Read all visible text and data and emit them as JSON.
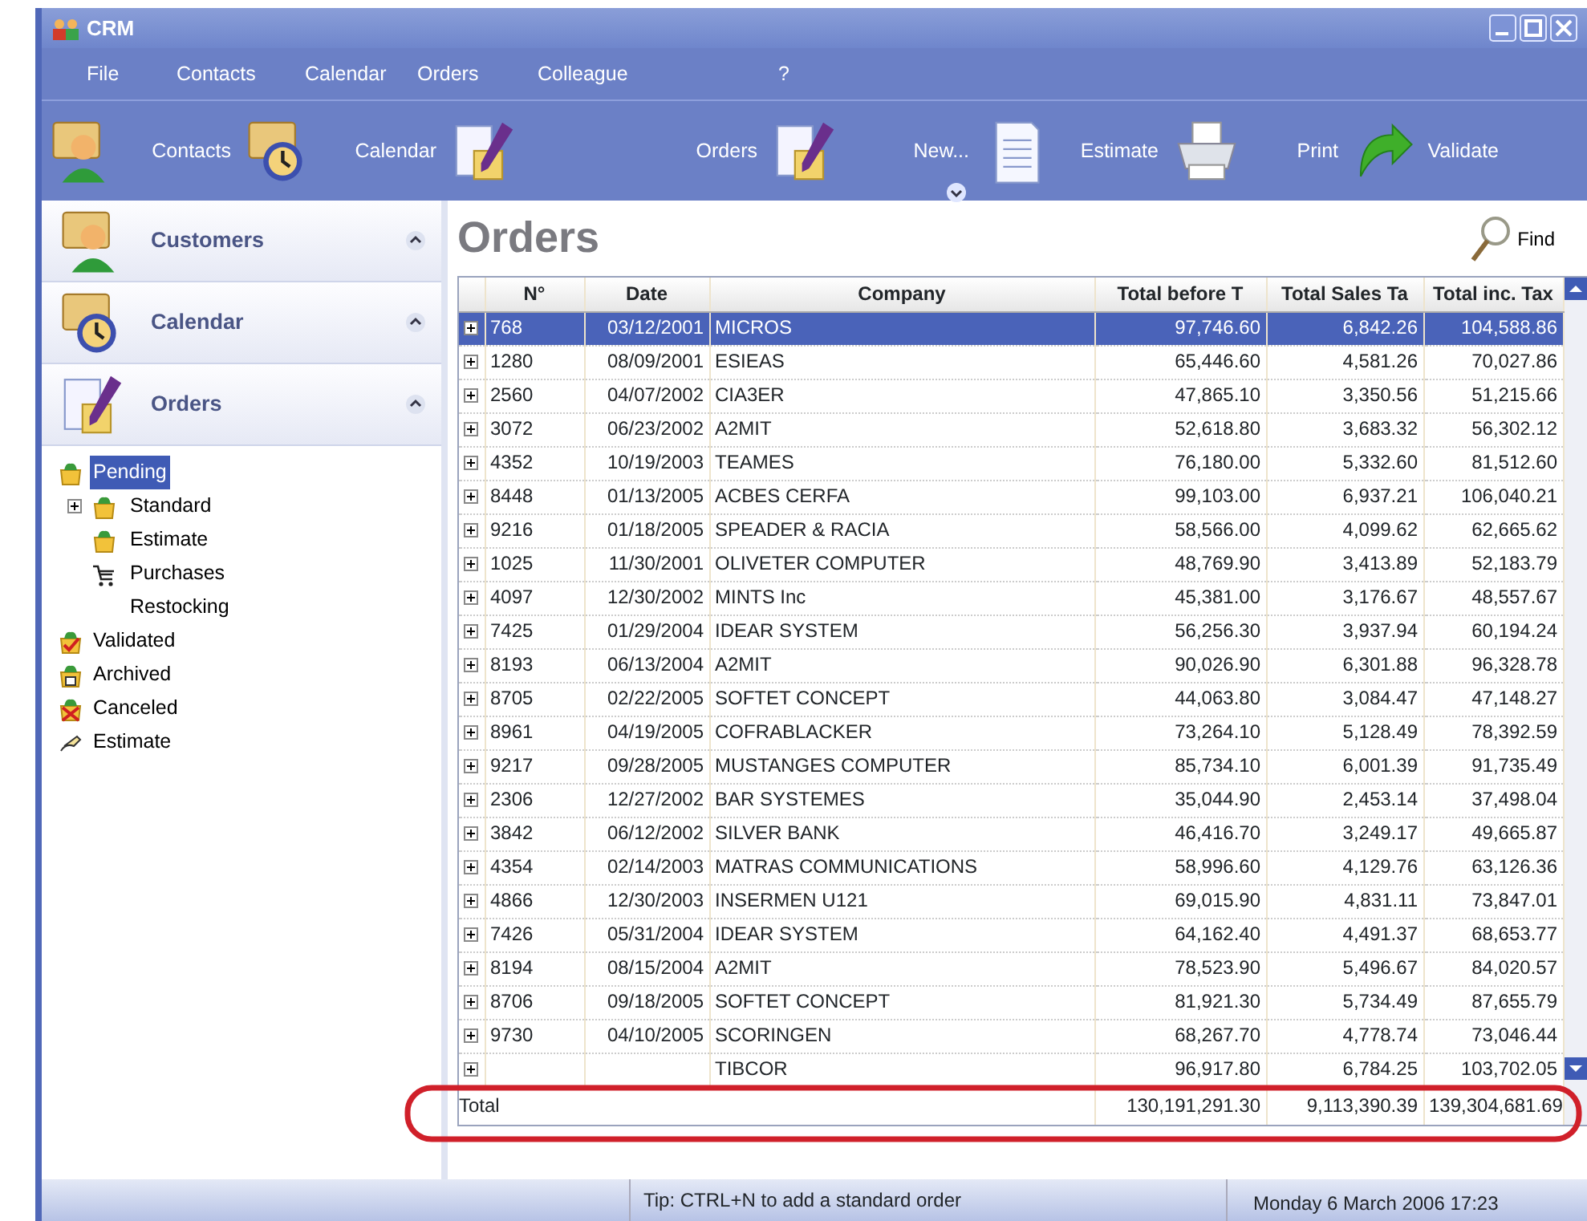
{
  "window": {
    "title": "CRM"
  },
  "menu": [
    "File",
    "Contacts",
    "Calendar",
    "Orders",
    "Colleague",
    "?"
  ],
  "toolbar": [
    {
      "label": "Contacts",
      "kind": "contacts"
    },
    {
      "label": "Calendar",
      "kind": "calendar"
    },
    {
      "label": "Orders",
      "kind": "orders"
    },
    {
      "label": "New...",
      "kind": "new"
    },
    {
      "label": "Estimate",
      "kind": "estimate"
    },
    {
      "label": "Print",
      "kind": "print"
    },
    {
      "label": "Validate",
      "kind": "validate"
    }
  ],
  "sidebar": {
    "panels": [
      {
        "title": "Customers",
        "kind": "contacts"
      },
      {
        "title": "Calendar",
        "kind": "calendar"
      },
      {
        "title": "Orders",
        "kind": "orders"
      }
    ],
    "tree": [
      {
        "label": "Pending",
        "kind": "bag",
        "selected": true,
        "children": [
          {
            "label": "Standard",
            "kind": "bag",
            "selected": false,
            "expandable": true
          },
          {
            "label": "Estimate",
            "kind": "bag",
            "selected": false
          },
          {
            "label": "Purchases",
            "kind": "cart",
            "selected": false
          },
          {
            "label": "Restocking",
            "kind": "none",
            "selected": false
          }
        ]
      },
      {
        "label": "Validated",
        "kind": "check",
        "selected": false
      },
      {
        "label": "Archived",
        "kind": "archive",
        "selected": false
      },
      {
        "label": "Canceled",
        "kind": "cancel",
        "selected": false
      },
      {
        "label": "Estimate",
        "kind": "pen",
        "selected": false
      }
    ]
  },
  "main": {
    "title": "Orders",
    "find_label": "Find",
    "table": {
      "columns": [
        "N°",
        "Date",
        "Company",
        "Total before T",
        "Total Sales Ta",
        "Total inc. Tax"
      ],
      "rows": [
        {
          "no": "768",
          "date": "03/12/2001",
          "company": "MICROS",
          "before": "97,746.60",
          "tax": "6,842.26",
          "total": "104,588.86",
          "selected": true
        },
        {
          "no": "1280",
          "date": "08/09/2001",
          "company": "ESIEAS",
          "before": "65,446.60",
          "tax": "4,581.26",
          "total": "70,027.86",
          "selected": false
        },
        {
          "no": "2560",
          "date": "04/07/2002",
          "company": "CIA3ER",
          "before": "47,865.10",
          "tax": "3,350.56",
          "total": "51,215.66",
          "selected": false
        },
        {
          "no": "3072",
          "date": "06/23/2002",
          "company": "A2MIT",
          "before": "52,618.80",
          "tax": "3,683.32",
          "total": "56,302.12",
          "selected": false
        },
        {
          "no": "4352",
          "date": "10/19/2003",
          "company": "TEAMES",
          "before": "76,180.00",
          "tax": "5,332.60",
          "total": "81,512.60",
          "selected": false
        },
        {
          "no": "8448",
          "date": "01/13/2005",
          "company": "ACBES CERFA",
          "before": "99,103.00",
          "tax": "6,937.21",
          "total": "106,040.21",
          "selected": false
        },
        {
          "no": "9216",
          "date": "01/18/2005",
          "company": "SPEADER & RACIA",
          "before": "58,566.00",
          "tax": "4,099.62",
          "total": "62,665.62",
          "selected": false
        },
        {
          "no": "1025",
          "date": "11/30/2001",
          "company": "OLIVETER COMPUTER",
          "before": "48,769.90",
          "tax": "3,413.89",
          "total": "52,183.79",
          "selected": false
        },
        {
          "no": "4097",
          "date": "12/30/2002",
          "company": "MINTS Inc",
          "before": "45,381.00",
          "tax": "3,176.67",
          "total": "48,557.67",
          "selected": false
        },
        {
          "no": "7425",
          "date": "01/29/2004",
          "company": "IDEAR SYSTEM",
          "before": "56,256.30",
          "tax": "3,937.94",
          "total": "60,194.24",
          "selected": false
        },
        {
          "no": "8193",
          "date": "06/13/2004",
          "company": "A2MIT",
          "before": "90,026.90",
          "tax": "6,301.88",
          "total": "96,328.78",
          "selected": false
        },
        {
          "no": "8705",
          "date": "02/22/2005",
          "company": "SOFTET CONCEPT",
          "before": "44,063.80",
          "tax": "3,084.47",
          "total": "47,148.27",
          "selected": false
        },
        {
          "no": "8961",
          "date": "04/19/2005",
          "company": "COFRABLACKER",
          "before": "73,264.10",
          "tax": "5,128.49",
          "total": "78,392.59",
          "selected": false
        },
        {
          "no": "9217",
          "date": "09/28/2005",
          "company": "MUSTANGES COMPUTER",
          "before": "85,734.10",
          "tax": "6,001.39",
          "total": "91,735.49",
          "selected": false
        },
        {
          "no": "2306",
          "date": "12/27/2002",
          "company": "BAR SYSTEMES",
          "before": "35,044.90",
          "tax": "2,453.14",
          "total": "37,498.04",
          "selected": false
        },
        {
          "no": "3842",
          "date": "06/12/2002",
          "company": "SILVER BANK",
          "before": "46,416.70",
          "tax": "3,249.17",
          "total": "49,665.87",
          "selected": false
        },
        {
          "no": "4354",
          "date": "02/14/2003",
          "company": "MATRAS COMMUNICATIONS",
          "before": "58,996.60",
          "tax": "4,129.76",
          "total": "63,126.36",
          "selected": false
        },
        {
          "no": "4866",
          "date": "12/30/2003",
          "company": "INSERMEN U121",
          "before": "69,015.90",
          "tax": "4,831.11",
          "total": "73,847.01",
          "selected": false
        },
        {
          "no": "7426",
          "date": "05/31/2004",
          "company": "IDEAR SYSTEM",
          "before": "64,162.40",
          "tax": "4,491.37",
          "total": "68,653.77",
          "selected": false
        },
        {
          "no": "8194",
          "date": "08/15/2004",
          "company": "A2MIT",
          "before": "78,523.90",
          "tax": "5,496.67",
          "total": "84,020.57",
          "selected": false
        },
        {
          "no": "8706",
          "date": "09/18/2005",
          "company": "SOFTET CONCEPT",
          "before": "81,921.30",
          "tax": "5,734.49",
          "total": "87,655.79",
          "selected": false
        },
        {
          "no": "9730",
          "date": "04/10/2005",
          "company": "SCORINGEN",
          "before": "68,267.70",
          "tax": "4,778.74",
          "total": "73,046.44",
          "selected": false
        },
        {
          "company": "TIBCOR",
          "before": "96,917.80",
          "tax": "6,784.25",
          "total": "103,702.05",
          "selected": false
        }
      ],
      "totals": {
        "label": "Total",
        "before": "130,191,291.30",
        "tax": "9,113,390.39",
        "total": "139,304,681.69"
      }
    }
  },
  "status_bar": {
    "tip": "Tip: CTRL+N to add a standard order",
    "datetime": "Monday 6 March 2006 17:23"
  }
}
